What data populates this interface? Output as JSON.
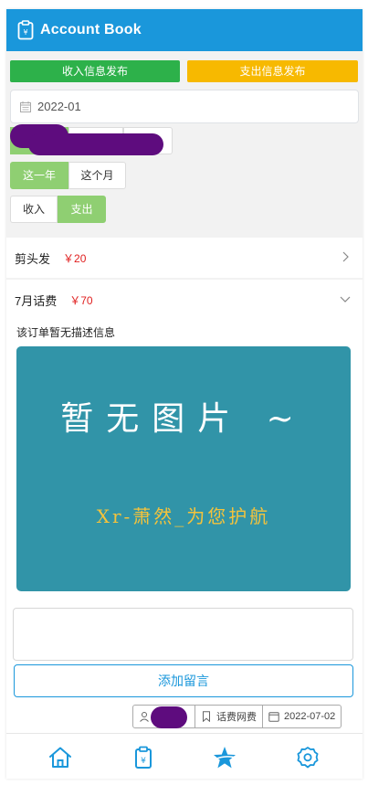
{
  "header": {
    "title": "Account Book",
    "logo_icon": "wallet-icon"
  },
  "actions": {
    "publish_income": "收入信息发布",
    "publish_expense": "支出信息发布"
  },
  "filter": {
    "date_value": "2022-01",
    "range_options": [
      "这一年",
      "这个月"
    ],
    "type_options": [
      "收入",
      "支出"
    ]
  },
  "records": [
    {
      "name": "剪头发",
      "amount": "￥20"
    },
    {
      "name": "7月话费",
      "amount": "￥70"
    }
  ],
  "detail": {
    "description": "该订单暂无描述信息",
    "image_text": "暂无图片 ~",
    "image_subtext": "Xr-萧然_为您护航",
    "comment_value": "",
    "add_comment": "添加留言",
    "category": "话费网费",
    "date": "2022-07-02"
  },
  "nav": [
    "home-icon",
    "wallet-icon",
    "star-icon",
    "settings-icon"
  ],
  "colors": {
    "primary": "#1a97db",
    "income": "#2db14a",
    "expense": "#f7b900",
    "selected": "#8fcf72",
    "amount": "#e02020"
  }
}
